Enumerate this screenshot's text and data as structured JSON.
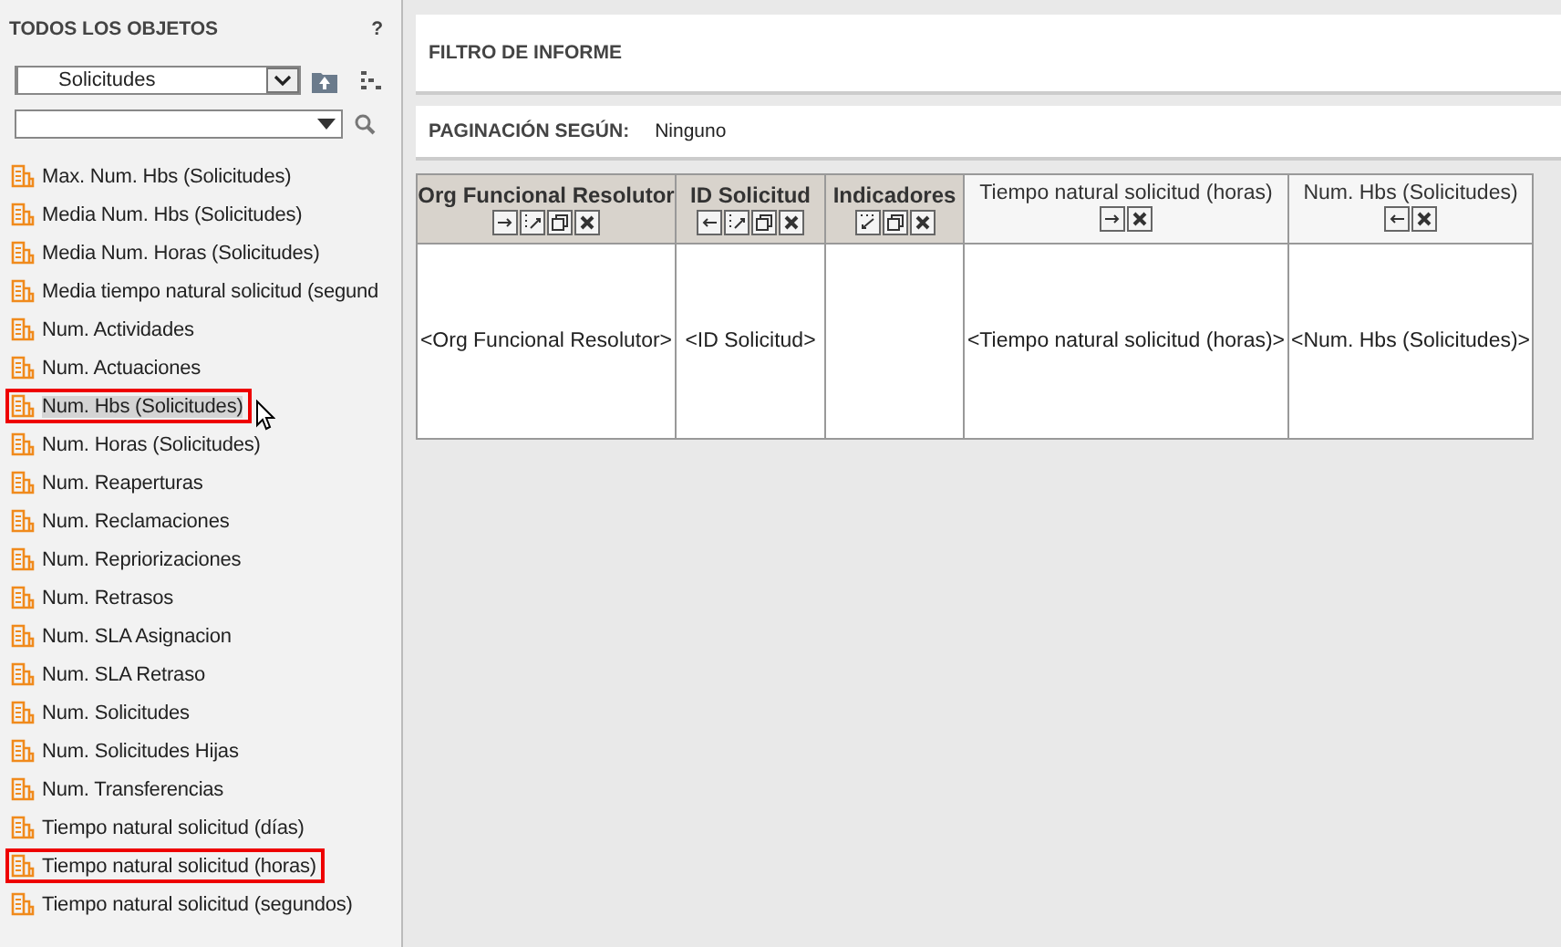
{
  "sidebar": {
    "title": "TODOS LOS OBJETOS",
    "help": "?",
    "folder_select": {
      "value": "Solicitudes"
    },
    "items": [
      {
        "label": "Max. Num. Hbs (Solicitudes)",
        "selected": false,
        "highlighted": false
      },
      {
        "label": "Media Num. Hbs (Solicitudes)",
        "selected": false,
        "highlighted": false
      },
      {
        "label": "Media Num. Horas (Solicitudes)",
        "selected": false,
        "highlighted": false
      },
      {
        "label": "Media tiempo natural solicitud (segund",
        "selected": false,
        "highlighted": false
      },
      {
        "label": "Num. Actividades",
        "selected": false,
        "highlighted": false
      },
      {
        "label": "Num. Actuaciones",
        "selected": false,
        "highlighted": false
      },
      {
        "label": "Num. Hbs (Solicitudes)",
        "selected": true,
        "highlighted": true
      },
      {
        "label": "Num. Horas (Solicitudes)",
        "selected": false,
        "highlighted": false
      },
      {
        "label": "Num. Reaperturas",
        "selected": false,
        "highlighted": false
      },
      {
        "label": "Num. Reclamaciones",
        "selected": false,
        "highlighted": false
      },
      {
        "label": "Num. Repriorizaciones",
        "selected": false,
        "highlighted": false
      },
      {
        "label": "Num. Retrasos",
        "selected": false,
        "highlighted": false
      },
      {
        "label": "Num. SLA Asignacion",
        "selected": false,
        "highlighted": false
      },
      {
        "label": "Num. SLA Retraso",
        "selected": false,
        "highlighted": false
      },
      {
        "label": "Num. Solicitudes",
        "selected": false,
        "highlighted": false
      },
      {
        "label": "Num. Solicitudes Hijas",
        "selected": false,
        "highlighted": false
      },
      {
        "label": "Num. Transferencias",
        "selected": false,
        "highlighted": false
      },
      {
        "label": "Tiempo natural solicitud (días)",
        "selected": false,
        "highlighted": false
      },
      {
        "label": "Tiempo natural solicitud (horas)",
        "selected": false,
        "highlighted": true
      },
      {
        "label": "Tiempo natural solicitud (segundos)",
        "selected": false,
        "highlighted": false
      }
    ]
  },
  "filter": {
    "title": "FILTRO DE INFORME"
  },
  "pagination": {
    "label": "PAGINACIÓN SEGÚN:",
    "value": "Ninguno"
  },
  "table": {
    "columns": [
      {
        "title": "Org Funcional Resolutor",
        "kind": "attribute",
        "buttons": [
          {
            "kind": "move-right"
          },
          {
            "kind": "pivot"
          },
          {
            "kind": "window"
          },
          {
            "kind": "close"
          }
        ],
        "cell": "<Org Funcional Resolutor>"
      },
      {
        "title": "ID Solicitud",
        "kind": "attribute",
        "buttons": [
          {
            "kind": "move-left"
          },
          {
            "kind": "pivot"
          },
          {
            "kind": "window"
          },
          {
            "kind": "close"
          }
        ],
        "cell": "<ID Solicitud>"
      },
      {
        "title": "Indicadores",
        "kind": "attribute",
        "buttons": [
          {
            "kind": "pivot-down"
          },
          {
            "kind": "window"
          },
          {
            "kind": "close"
          }
        ]
      },
      {
        "title": "Tiempo natural solicitud (horas)",
        "kind": "metric",
        "buttons": [
          {
            "kind": "move-right"
          },
          {
            "kind": "close"
          }
        ],
        "cell": "<Tiempo natural solicitud (horas)>"
      },
      {
        "title": "Num. Hbs (Solicitudes)",
        "kind": "metric",
        "buttons": [
          {
            "kind": "move-left"
          },
          {
            "kind": "close"
          }
        ],
        "cell": "<Num. Hbs (Solicitudes)>"
      }
    ]
  }
}
